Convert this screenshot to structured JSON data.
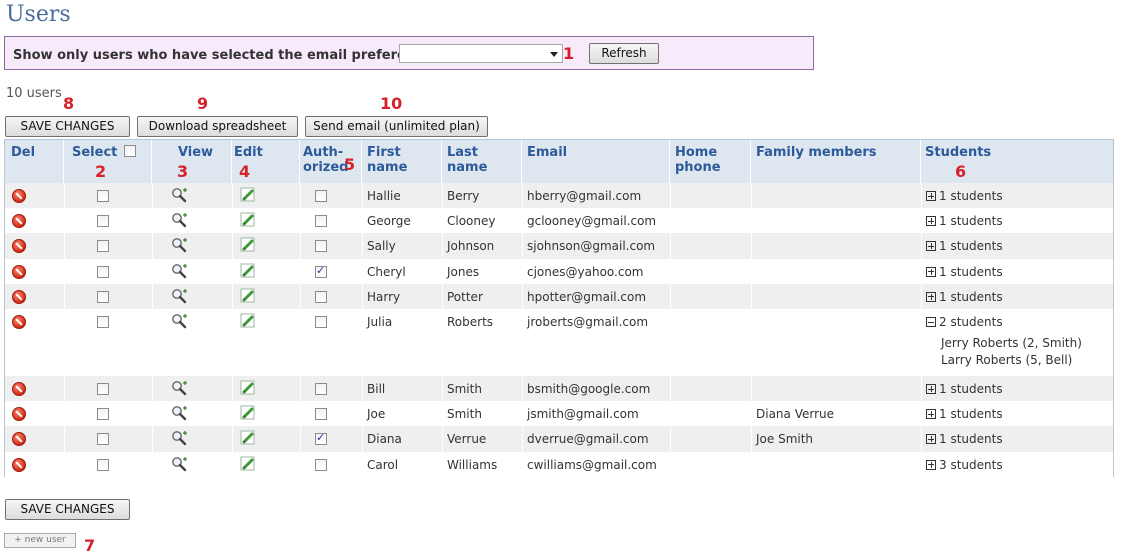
{
  "page": {
    "title": "Users"
  },
  "filter": {
    "label": "Show only users who have selected the email preference:",
    "selected_value": "",
    "refresh_label": "Refresh"
  },
  "markers": [
    "1",
    "2",
    "3",
    "4",
    "5",
    "6",
    "7",
    "8",
    "9",
    "10"
  ],
  "user_count": "10 users",
  "toolbar": {
    "save_label": "SAVE CHANGES",
    "download_label": "Download spreadsheet",
    "email_label": "Send email (unlimited plan)"
  },
  "table": {
    "headers": {
      "del": "Del",
      "select": "Select",
      "view": "View",
      "edit": "Edit",
      "authorized_1": "Auth-",
      "authorized_2": "orized",
      "first_1": "First",
      "first_2": "name",
      "last": "Last name",
      "email": "Email",
      "phone_1": "Home",
      "phone_2": "phone",
      "family": "Family members",
      "students": "Students"
    },
    "rows": [
      {
        "first": "Hallie",
        "last": "Berry",
        "email": "hberry@gmail.com",
        "phone": "",
        "family": "",
        "students": "1 students",
        "expanded": false,
        "authorized": false,
        "details": []
      },
      {
        "first": "George",
        "last": "Clooney",
        "email": "gclooney@gmail.com",
        "phone": "",
        "family": "",
        "students": "1 students",
        "expanded": false,
        "authorized": false,
        "details": []
      },
      {
        "first": "Sally",
        "last": "Johnson",
        "email": "sjohnson@gmail.com",
        "phone": "",
        "family": "",
        "students": "1 students",
        "expanded": false,
        "authorized": false,
        "details": []
      },
      {
        "first": "Cheryl",
        "last": "Jones",
        "email": "cjones@yahoo.com",
        "phone": "",
        "family": "",
        "students": "1 students",
        "expanded": false,
        "authorized": true,
        "details": []
      },
      {
        "first": "Harry",
        "last": "Potter",
        "email": "hpotter@gmail.com",
        "phone": "",
        "family": "",
        "students": "1 students",
        "expanded": false,
        "authorized": false,
        "details": []
      },
      {
        "first": "Julia",
        "last": "Roberts",
        "email": "jroberts@gmail.com",
        "phone": "",
        "family": "",
        "students": "2 students",
        "expanded": true,
        "authorized": false,
        "details": [
          "Jerry Roberts (2, Smith)",
          "Larry Roberts (5, Bell)"
        ]
      },
      {
        "first": "Bill",
        "last": "Smith",
        "email": "bsmith@google.com",
        "phone": "",
        "family": "",
        "students": "1 students",
        "expanded": false,
        "authorized": false,
        "details": []
      },
      {
        "first": "Joe",
        "last": "Smith",
        "email": "jsmith@gmail.com",
        "phone": "",
        "family": "Diana Verrue",
        "students": "1 students",
        "expanded": false,
        "authorized": false,
        "details": []
      },
      {
        "first": "Diana",
        "last": "Verrue",
        "email": "dverrue@gmail.com",
        "phone": "",
        "family": "Joe Smith",
        "students": "1 students",
        "expanded": false,
        "authorized": true,
        "details": []
      },
      {
        "first": "Carol",
        "last": "Williams",
        "email": "cwilliams@gmail.com",
        "phone": "",
        "family": "",
        "students": "3 students",
        "expanded": false,
        "authorized": false,
        "details": []
      }
    ]
  },
  "footer": {
    "save_label": "SAVE CHANGES",
    "new_user_label": "+ new user"
  },
  "colors": {
    "header_text": "#2c5a9a",
    "header_bg": "#dee6ef",
    "marker": "#d6202a",
    "filter_bg": "#f7eafb"
  },
  "icons": {
    "delete": "delete-icon",
    "view": "magnifier-icon",
    "edit": "pencil-icon",
    "expand": "plus-box-icon",
    "collapse": "minus-box-icon"
  }
}
